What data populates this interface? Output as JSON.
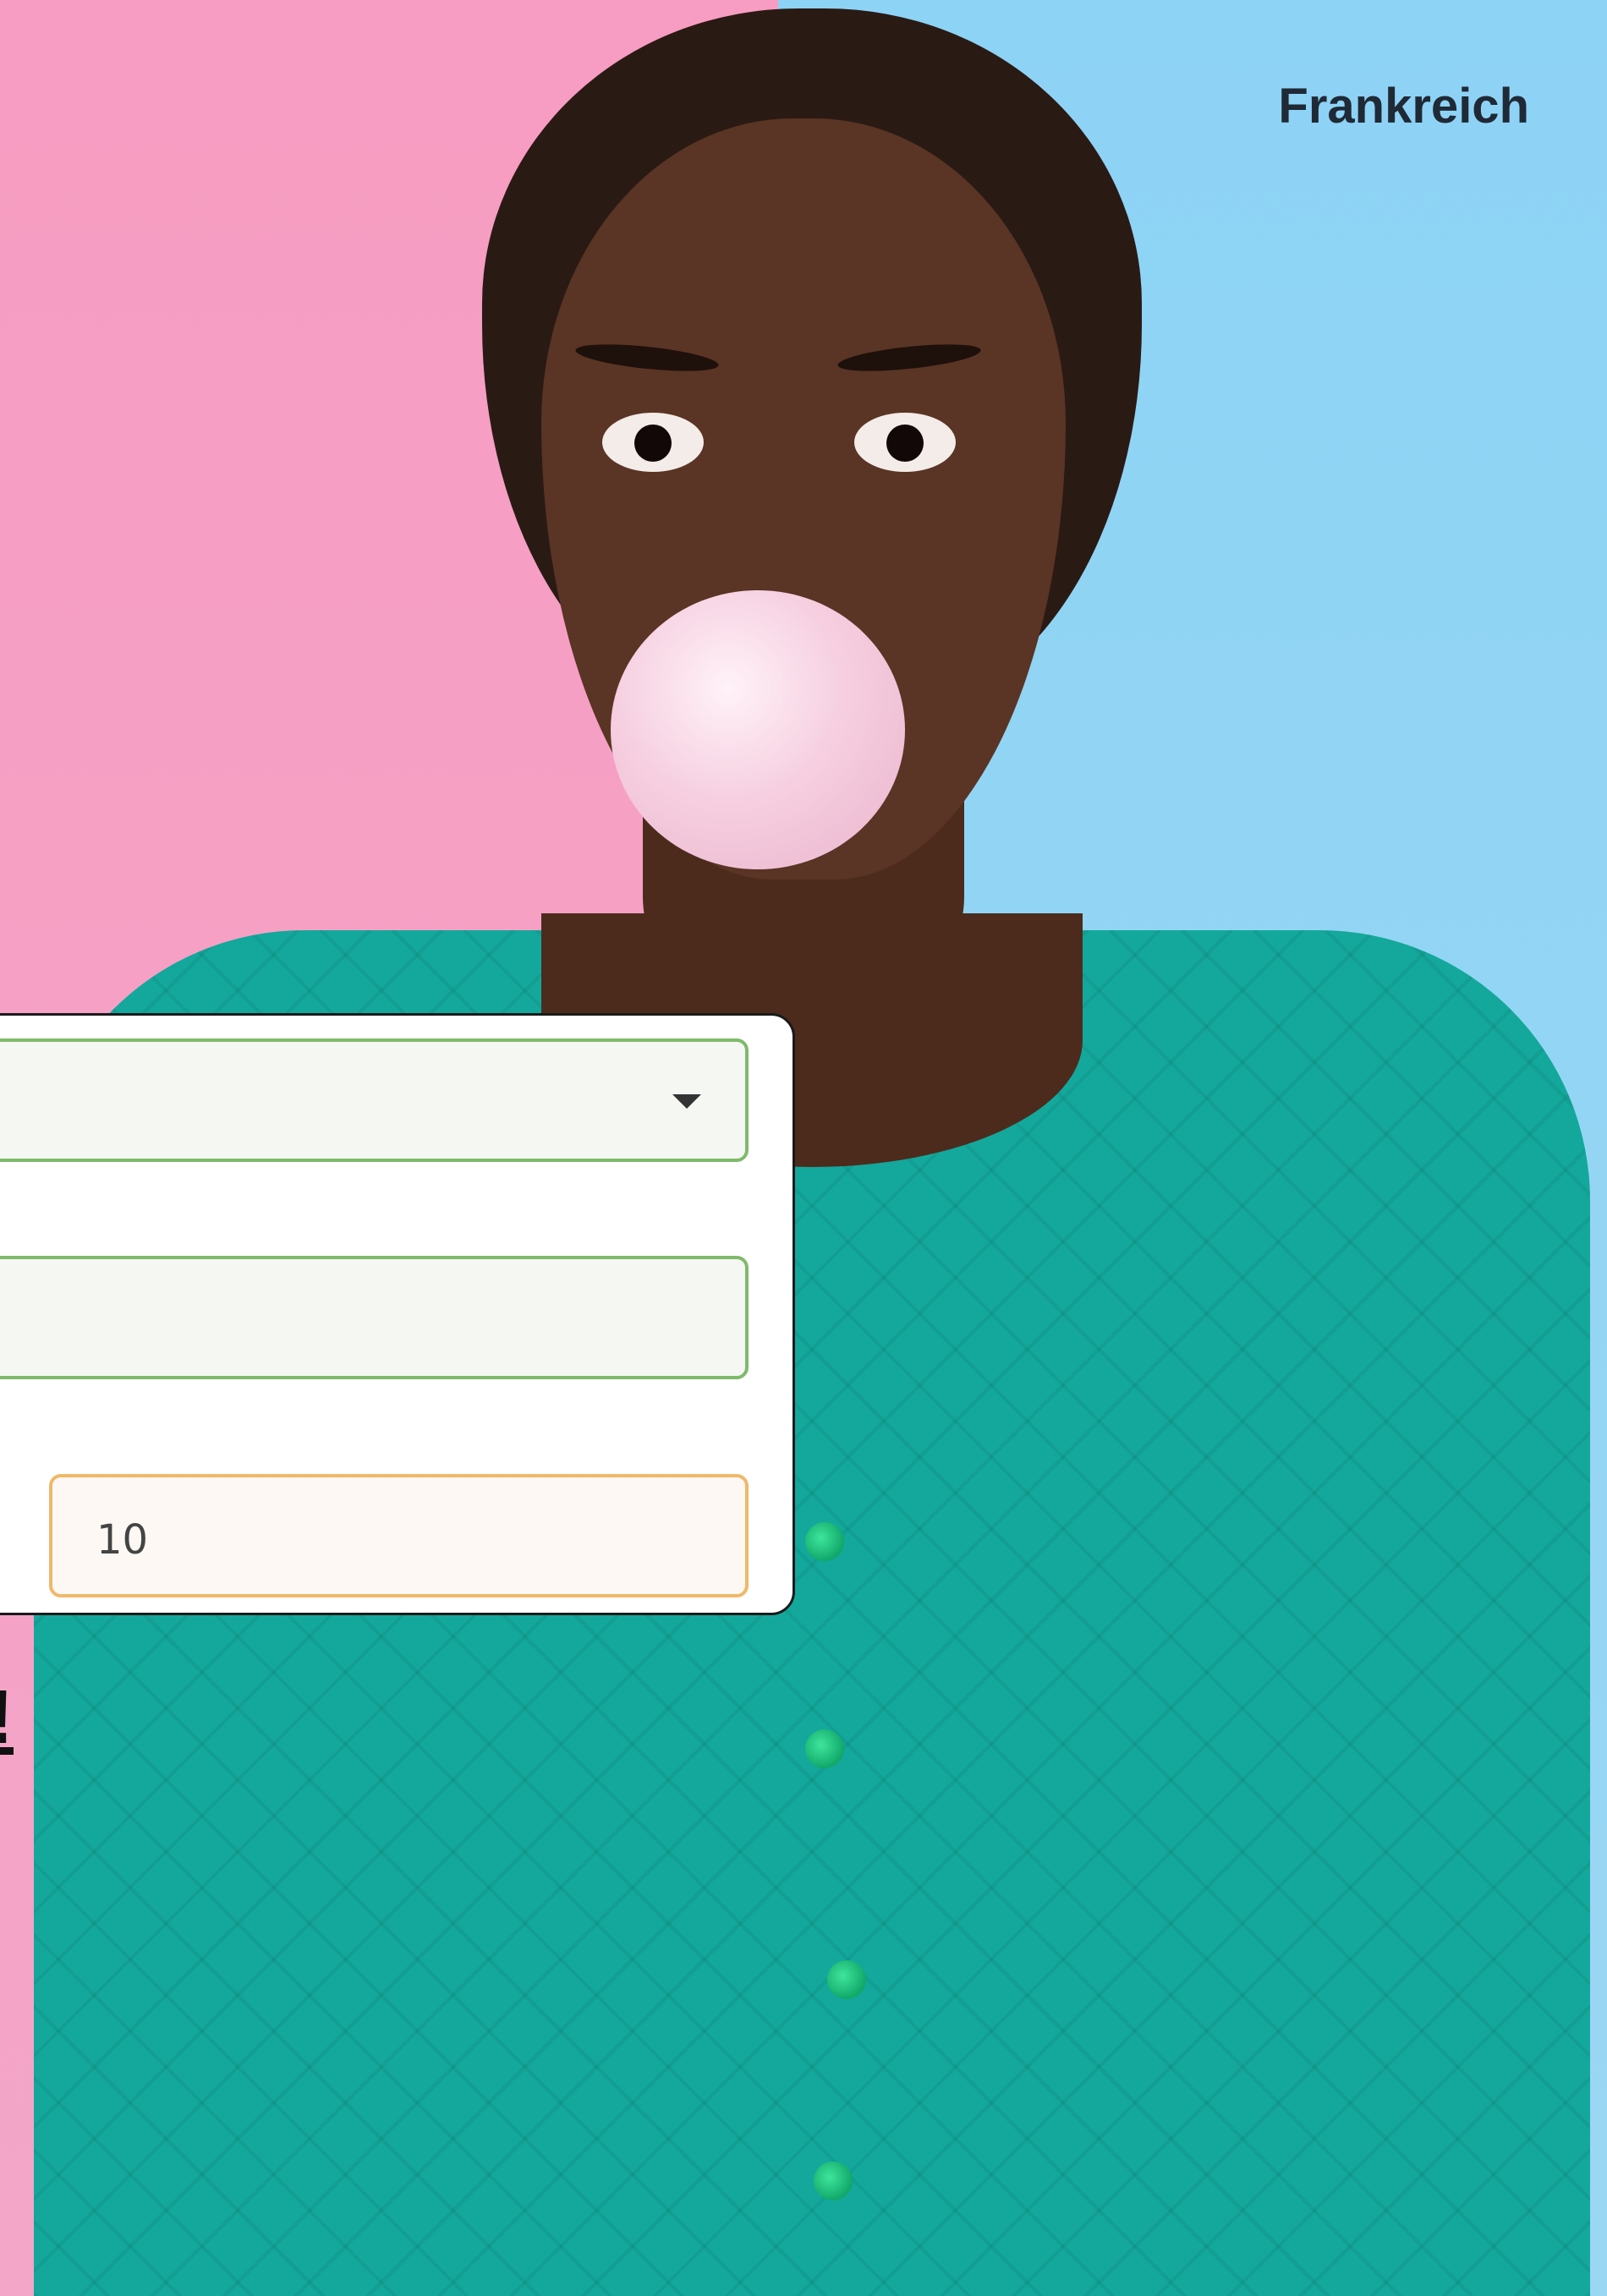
{
  "header": {
    "country": "Frankreich"
  },
  "form": {
    "select_value": "",
    "text_value": "",
    "number_value": "10"
  },
  "fragment": {
    "text": "!"
  },
  "colors": {
    "pink_bg": "#f79cc2",
    "blue_bg": "#8dd3f5",
    "sweater": "#13a89b",
    "valid_border": "#7fba6b",
    "focus_border": "#f0b869"
  }
}
